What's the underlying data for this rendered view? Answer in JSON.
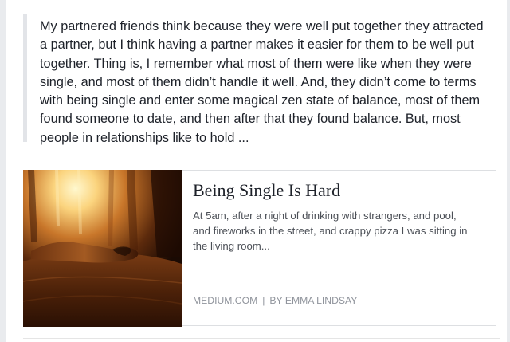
{
  "post": {
    "quote_text": "My partnered friends think because they were well put together they attracted a partner, but I think having a partner makes it easier for them to be well put together. Thing is, I remember what most of them were like when they were single, and most of them didn’t handle it well. And, they didn’t come to terms with being single and enter some magical zen state of balance, most of them found someone to date, and then after that they found balance. But, most people in relationships like to hold ..."
  },
  "link_card": {
    "title": "Being Single Is Hard",
    "description": "At 5am, after a night of drinking with strangers, and pool, and fireworks in the street, and crappy pizza I was sitting in the living room...",
    "source": "MEDIUM.COM",
    "separator": "|",
    "author": "BY EMMA LINDSAY",
    "image_icon": "photo-thumbnail"
  },
  "colors": {
    "text_primary": "#1d2129",
    "text_secondary": "#4b4f56",
    "text_meta": "#90949c",
    "quote_bar": "#e2e4e8",
    "card_border": "#dddfe2"
  }
}
